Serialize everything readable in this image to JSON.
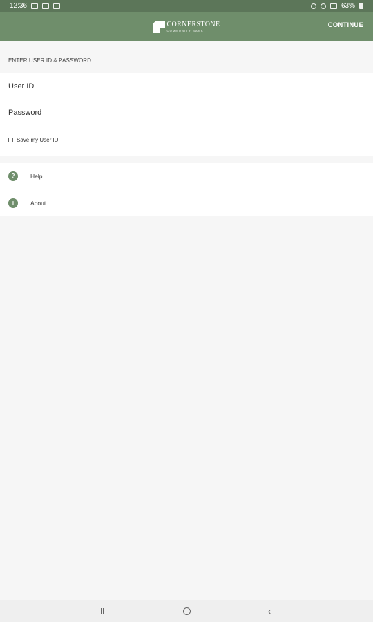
{
  "status_bar": {
    "time": "12:36",
    "battery": "63%"
  },
  "app_bar": {
    "logo_name": "CORNERSTONE",
    "logo_sub": "COMMUNITY BANK",
    "continue_label": "CONTINUE"
  },
  "login": {
    "section_header": "ENTER USER ID & PASSWORD",
    "user_id_label": "User ID",
    "password_label": "Password",
    "save_label": "Save my User ID"
  },
  "menu": {
    "items": [
      {
        "label": "Help",
        "icon": "question-icon",
        "glyph": "?"
      },
      {
        "label": "About",
        "icon": "info-icon",
        "glyph": "i"
      }
    ]
  },
  "colors": {
    "accent": "#6f8e6b",
    "status_bar": "#5c7659",
    "background": "#f6f6f6"
  }
}
